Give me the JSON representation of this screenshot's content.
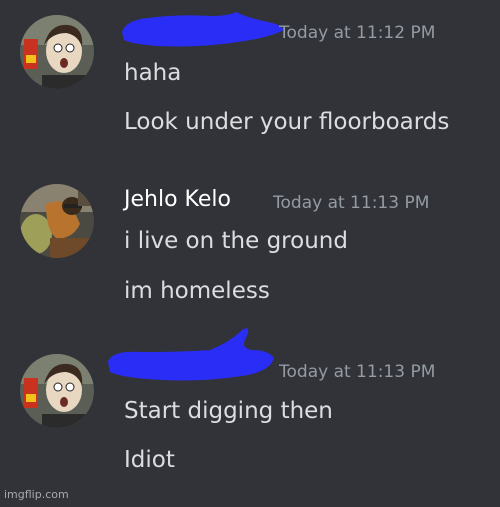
{
  "messages": [
    {
      "author": "",
      "author_redacted": true,
      "avatar_icon": "user-avatar-icon",
      "timestamp": "Today at 11:12 PM",
      "lines": [
        "haha",
        "Look under your floorboards"
      ]
    },
    {
      "author": "Jehlo Kelo",
      "author_redacted": false,
      "avatar_icon": "user-avatar-icon",
      "timestamp": "Today at 11:13 PM",
      "lines": [
        "i live on the ground",
        "im homeless"
      ]
    },
    {
      "author": "",
      "author_redacted": true,
      "avatar_icon": "user-avatar-icon",
      "timestamp": "Today at 11:13 PM",
      "lines": [
        "Start digging then",
        "Idiot"
      ]
    }
  ],
  "watermark": "imgflip.com",
  "colors": {
    "background": "#313338",
    "username": "#ffffff",
    "message_text": "#dbdee1",
    "timestamp": "#949ba4",
    "redaction": "#2a2df5"
  }
}
